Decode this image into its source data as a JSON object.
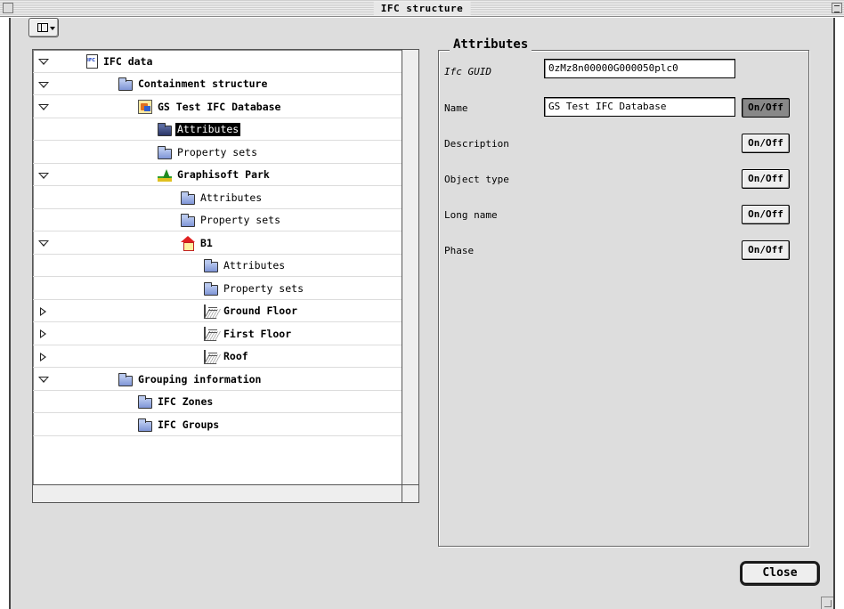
{
  "window": {
    "title": "IFC structure"
  },
  "tree": {
    "rows": [
      {
        "label": "IFC data",
        "bold": true,
        "expanded": "down",
        "icon": "ifc-document-icon"
      },
      {
        "label": "Containment structure",
        "bold": true,
        "expanded": "down",
        "icon": "folder-icon"
      },
      {
        "label": "GS Test IFC Database",
        "bold": true,
        "expanded": "down",
        "icon": "project-database-icon"
      },
      {
        "label": "Attributes",
        "bold": false,
        "selected": true,
        "icon": "folder-icon"
      },
      {
        "label": "Property sets",
        "bold": false,
        "icon": "folder-icon"
      },
      {
        "label": "Graphisoft Park",
        "bold": true,
        "expanded": "down",
        "icon": "site-icon"
      },
      {
        "label": "Attributes",
        "bold": false,
        "icon": "folder-icon"
      },
      {
        "label": "Property sets",
        "bold": false,
        "icon": "folder-icon"
      },
      {
        "label": "B1",
        "bold": true,
        "expanded": "down",
        "icon": "building-icon"
      },
      {
        "label": "Attributes",
        "bold": false,
        "icon": "folder-icon"
      },
      {
        "label": "Property sets",
        "bold": false,
        "icon": "folder-icon"
      },
      {
        "label": "Ground Floor",
        "bold": true,
        "expanded": "right",
        "icon": "storey-icon"
      },
      {
        "label": "First Floor",
        "bold": true,
        "expanded": "right",
        "icon": "storey-icon"
      },
      {
        "label": "Roof",
        "bold": true,
        "expanded": "right",
        "icon": "storey-icon"
      },
      {
        "label": "Grouping information",
        "bold": true,
        "expanded": "down",
        "icon": "folder-icon"
      },
      {
        "label": "IFC Zones",
        "bold": true,
        "icon": "folder-icon"
      },
      {
        "label": "IFC Groups",
        "bold": true,
        "icon": "folder-icon"
      }
    ]
  },
  "attributes": {
    "title": "Attributes",
    "guid_label": "Ifc GUID",
    "guid_value": "0zMz8n00000G000050plc0",
    "name_label": "Name",
    "name_value": "GS Test IFC Database",
    "description_label": "Description",
    "object_type_label": "Object type",
    "long_name_label": "Long name",
    "phase_label": "Phase",
    "onoff_label": "On/Off"
  },
  "buttons": {
    "close_label": "Close"
  }
}
